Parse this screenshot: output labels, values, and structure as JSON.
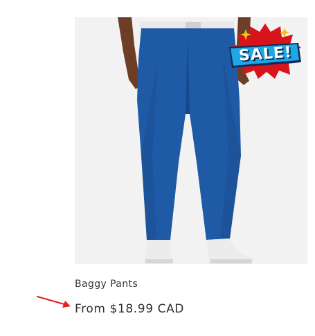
{
  "product": {
    "title": "Baggy Pants",
    "price": "From $18.99 CAD",
    "badge_text": "SALE!",
    "image_icon": "pants-photo"
  },
  "colors": {
    "pants": "#1f5aa6",
    "badge_red": "#d7141c",
    "badge_blue": "#1da7e4",
    "annotation_arrow": "#e0201b",
    "image_background": "#f2f2f2"
  }
}
